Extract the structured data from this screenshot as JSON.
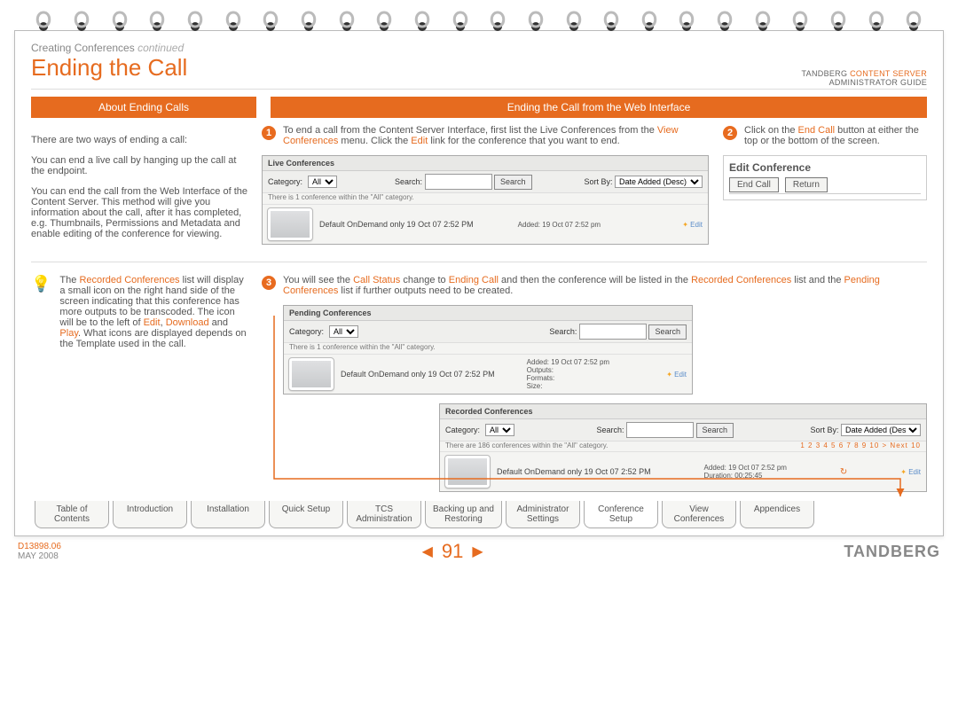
{
  "header": {
    "breadcrumb_main": "Creating Conferences",
    "breadcrumb_sub": "continued",
    "title": "Ending the Call",
    "brand_line1a": "TANDBERG",
    "brand_line1b": "CONTENT SERVER",
    "brand_line2": "ADMINISTRATOR GUIDE"
  },
  "banners": {
    "left": "About Ending Calls",
    "right": "Ending the Call from the Web Interface"
  },
  "left_top": {
    "p1": "There are two ways of ending a call:",
    "p2": "You can end a live call by hanging up the call at the endpoint.",
    "p3": "You can end the call from the Web Interface of the Content Server. This method will give you information about the call, after it has completed, e.g. Thumbnails, Permissions and Metadata and enable editing of the conference for viewing."
  },
  "left_tip": {
    "a": "The ",
    "rc": "Recorded Conferences",
    "b": " list will display a small icon on the right hand side of the screen indicating that this conference has more outputs to be transcoded. The icon will be to the left of ",
    "edit": "Edit",
    "comma": ", ",
    "download": "Download",
    "and": " and ",
    "play": "Play",
    "c": ". What icons are displayed depends on the Template used in the call."
  },
  "step1": {
    "num": "1",
    "a": "To end a call from the Content Server Interface, first list the Live Conferences from the ",
    "view": "View Conferences",
    "b": " menu. Click the ",
    "edit": "Edit",
    "c": " link for the conference that you want to end."
  },
  "step2": {
    "num": "2",
    "a": "Click on the ",
    "endcall": "End Call",
    "b": " button at either the top or the bottom of the screen."
  },
  "step3": {
    "num": "3",
    "a": "You will see the ",
    "cs": "Call Status",
    "b": " change to ",
    "ec": "Ending Call",
    "c": " and then the conference will be listed in the ",
    "rc": "Recorded Conferences",
    "d": " list and the ",
    "pc": "Pending Conferences",
    "e": " list if further outputs need to be created."
  },
  "live": {
    "title": "Live Conferences",
    "cat_label": "Category:",
    "cat_value": "All",
    "note": "There is 1 conference within the \"All\" category.",
    "search_label": "Search:",
    "search_btn": "Search",
    "sort_label": "Sort By:",
    "sort_value": "Date Added (Desc)",
    "row_title": "Default OnDemand only 19 Oct 07 2:52 PM",
    "row_meta": "Added: 19 Oct 07 2:52 pm",
    "edit": "Edit"
  },
  "editconf": {
    "title": "Edit Conference",
    "btn_end": "End Call",
    "btn_return": "Return"
  },
  "pending": {
    "title": "Pending Conferences",
    "cat_label": "Category:",
    "cat_value": "All",
    "note": "There is 1 conference within the \"All\" category.",
    "search_label": "Search:",
    "search_btn": "Search",
    "row_title": "Default OnDemand only 19 Oct 07 2:52 PM",
    "meta1": "Added: 19 Oct 07 2:52 pm",
    "meta2": "Outputs:",
    "meta3": "Formats:",
    "meta4": "Size:",
    "edit": "Edit"
  },
  "recorded": {
    "title": "Recorded Conferences",
    "cat_label": "Category:",
    "cat_value": "All",
    "note": "There are 186 conferences within the \"All\" category.",
    "search_label": "Search:",
    "search_btn": "Search",
    "sort_label": "Sort By:",
    "sort_value": "Date Added (Desc)",
    "pager": "1 2 3 4 5 6 7 8 9 10 > Next 10",
    "row_title": "Default OnDemand only 19 Oct 07 2:52 PM",
    "meta1": "Added: 19 Oct 07 2:52 pm",
    "meta2": "Duration: 00:25:45",
    "edit": "Edit"
  },
  "tabs": [
    "Table of\nContents",
    "Introduction",
    "Installation",
    "Quick Setup",
    "TCS\nAdministration",
    "Backing up and\nRestoring",
    "Administrator\nSettings",
    "Conference\nSetup",
    "View\nConferences",
    "Appendices"
  ],
  "active_tab": 7,
  "footer": {
    "doc": "D13898.06",
    "date": "MAY 2008",
    "page": "91",
    "brand": "TANDBERG"
  }
}
